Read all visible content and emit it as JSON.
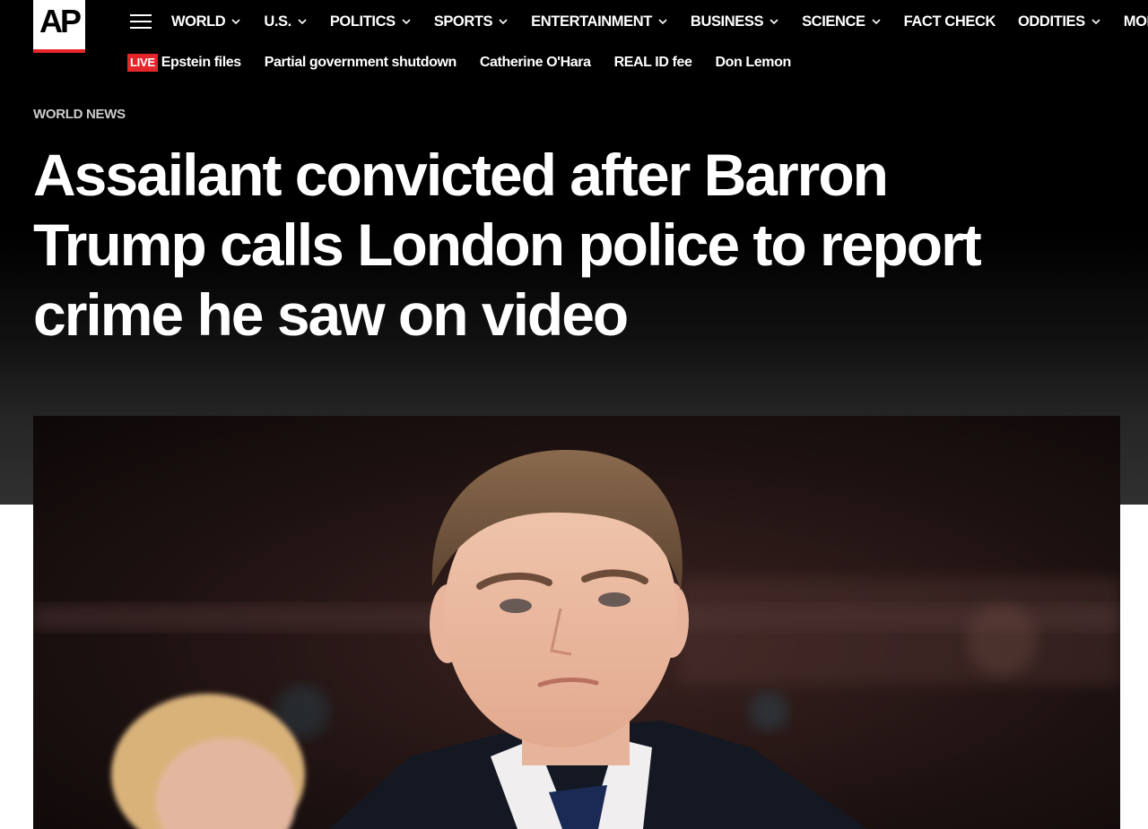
{
  "brand": {
    "logo_text": "AP"
  },
  "nav": {
    "menu_icon": "hamburger-menu-icon",
    "items": [
      {
        "label": "WORLD",
        "has_dropdown": true
      },
      {
        "label": "U.S.",
        "has_dropdown": true
      },
      {
        "label": "POLITICS",
        "has_dropdown": true
      },
      {
        "label": "SPORTS",
        "has_dropdown": true
      },
      {
        "label": "ENTERTAINMENT",
        "has_dropdown": true
      },
      {
        "label": "BUSINESS",
        "has_dropdown": true
      },
      {
        "label": "SCIENCE",
        "has_dropdown": true
      },
      {
        "label": "FACT CHECK",
        "has_dropdown": false
      },
      {
        "label": "ODDITIES",
        "has_dropdown": true
      },
      {
        "label": "MORE",
        "has_dropdown": true
      }
    ]
  },
  "trending": {
    "live_badge": "LIVE",
    "links": [
      "Epstein files",
      "Partial government shutdown",
      "Catherine O'Hara",
      "REAL ID fee",
      "Don Lemon"
    ]
  },
  "article": {
    "kicker": "WORLD NEWS",
    "headline_lines": [
      "Assailant convicted after Barron",
      "Trump calls London police to report",
      "crime he saw on video"
    ]
  },
  "colors": {
    "accent_red": "#e4262a",
    "header_bg": "#000000",
    "text_light": "#ffffff"
  }
}
